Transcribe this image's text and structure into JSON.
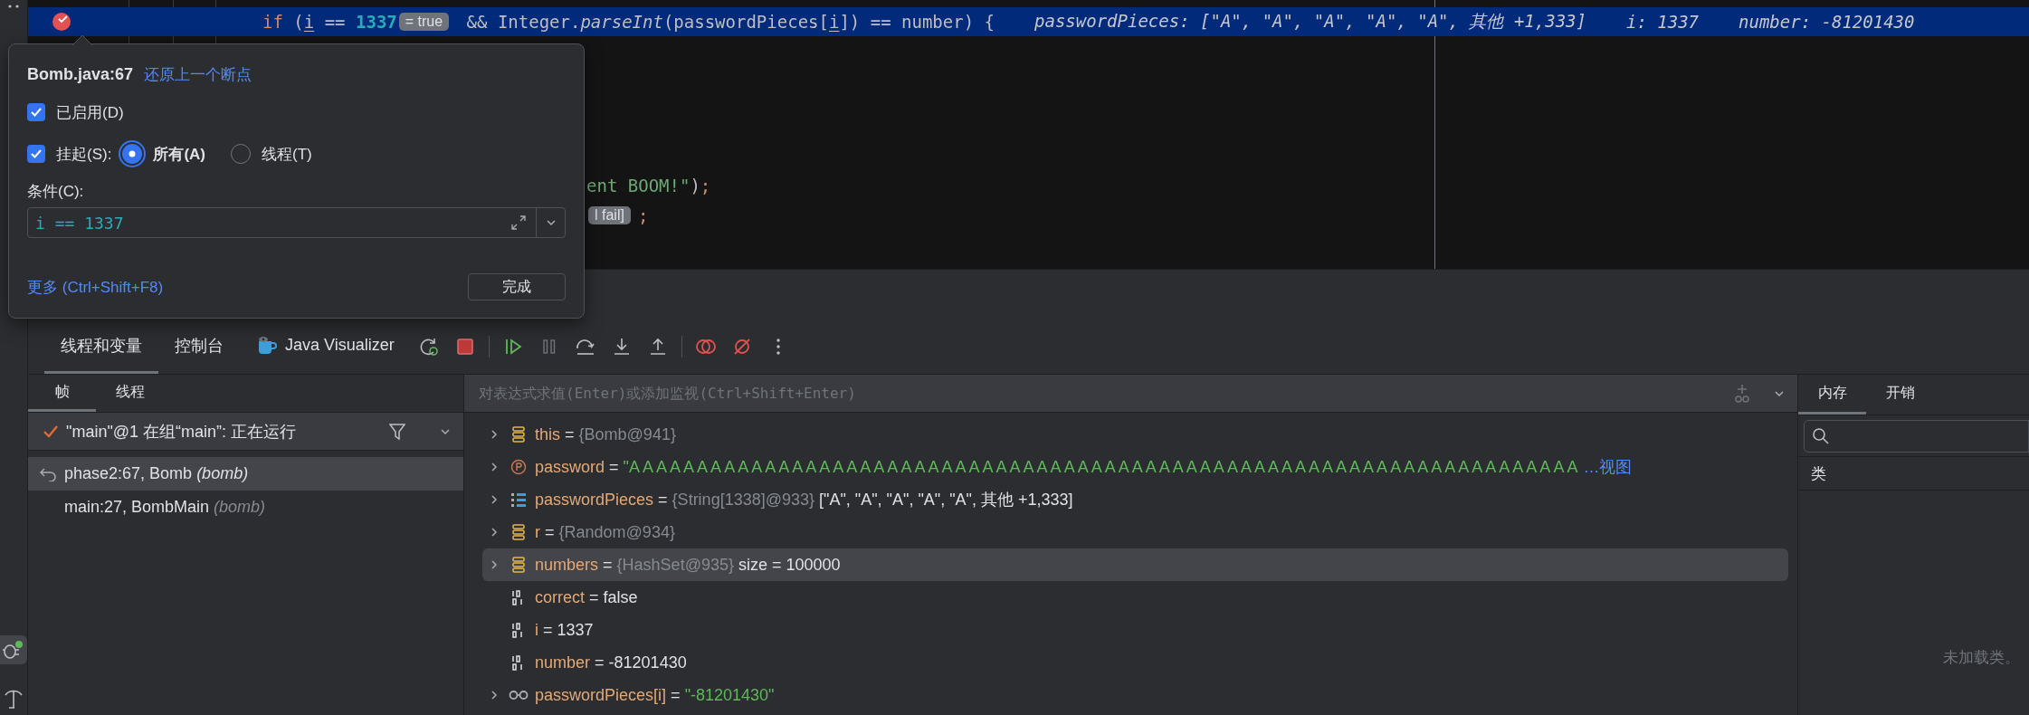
{
  "editor": {
    "current_line": {
      "tokens": [
        {
          "text": "if",
          "kind": "keyword"
        },
        {
          "text": " (",
          "kind": "plain"
        },
        {
          "text": "i",
          "kind": "var"
        },
        {
          "text": " == ",
          "kind": "plain"
        },
        {
          "text": "1337",
          "kind": "number"
        },
        {
          "text": "= true",
          "kind": "hint"
        },
        {
          "text": " && Integer.",
          "kind": "plain"
        },
        {
          "text": "parseInt",
          "kind": "method"
        },
        {
          "text": "(passwordPieces[",
          "kind": "plain"
        },
        {
          "text": "i",
          "kind": "var"
        },
        {
          "text": "]) == number) {",
          "kind": "plain"
        }
      ],
      "inline_values": [
        "passwordPieces: [\"A\", \"A\", \"A\", \"A\", \"A\", 其他 +1,333]",
        "i: 1337",
        "number: -81201430"
      ]
    },
    "partial_lines": [
      {
        "tokens": [
          {
            "text": "ent BOOM!\"",
            "kind": "string"
          },
          {
            "text": ")",
            "kind": "plain"
          },
          {
            "text": ";",
            "kind": "punct"
          }
        ]
      },
      {
        "tokens": [
          {
            "text": "l fail]",
            "kind": "hint"
          },
          {
            "text": ";",
            "kind": "punct"
          }
        ]
      }
    ]
  },
  "breakpoint_popup": {
    "title": "Bomb.java:67",
    "restore_link": "还原上一个断点",
    "enabled": {
      "label": "已启用(D)",
      "checked": true
    },
    "suspend": {
      "label": "挂起(S):",
      "checked": true
    },
    "suspend_options": [
      {
        "label": "所有(A)",
        "selected": true
      },
      {
        "label": "线程(T)",
        "selected": false
      }
    ],
    "condition_label": "条件(C):",
    "condition": "i == 1337",
    "more_link": "更多 (Ctrl+Shift+F8)",
    "done_button": "完成"
  },
  "debug_tabs": [
    {
      "label": "线程和变量",
      "selected": true,
      "kind": "text"
    },
    {
      "label": "控制台",
      "selected": false,
      "kind": "text"
    },
    {
      "label": "Java Visualizer",
      "selected": false,
      "kind": "plugin"
    }
  ],
  "frames_panel": {
    "tabs": [
      {
        "label": "帧",
        "selected": true
      },
      {
        "label": "线程",
        "selected": false
      }
    ],
    "thread": "\"main\"@1 在组“main”: 正在运行",
    "frames": [
      {
        "method": "phase2:67, Bomb",
        "package": "(bomb)",
        "selected": true
      },
      {
        "method": "main:27, BombMain",
        "package": "(bomb)",
        "selected": false
      }
    ]
  },
  "variables_panel": {
    "placeholder": "对表达式求值(Enter)或添加监视(Ctrl+Shift+Enter)",
    "variables": [
      {
        "name": "this",
        "sep": "=",
        "kind": "object",
        "type": "{Bomb@941}",
        "expandable": true,
        "selected": false
      },
      {
        "name": "password",
        "sep": "=",
        "kind": "field",
        "value": {
          "text": "\"A A A A A A A A A A A A A A A A A A A A A A A A A A A A A A A A A A A A A A A A A A A A A A A A A A A A A A A A A A A A A A A A A A A A A A",
          "kind": "string"
        },
        "link": "…视图",
        "expandable": true,
        "selected": false
      },
      {
        "name": "passwordPieces",
        "sep": "=",
        "kind": "array",
        "type": "{String[1338]@933}",
        "value": {
          "text": "[\"A\", \"A\", \"A\", \"A\", \"A\", 其他 +1,333]",
          "kind": "plain"
        },
        "expandable": true,
        "selected": false
      },
      {
        "name": "r",
        "sep": "=",
        "kind": "object",
        "type": "{Random@934}",
        "expandable": true,
        "selected": false
      },
      {
        "name": "numbers",
        "sep": "=",
        "kind": "object",
        "type": "{HashSet@935}",
        "value": {
          "text": "size = 100000",
          "kind": "plain"
        },
        "expandable": true,
        "selected": true
      },
      {
        "name": "correct",
        "sep": "=",
        "kind": "primitive",
        "value": {
          "text": "false",
          "kind": "plain"
        },
        "expandable": false,
        "selected": false
      },
      {
        "name": "i",
        "sep": "=",
        "kind": "primitive",
        "value": {
          "text": "1337",
          "kind": "plain"
        },
        "expandable": false,
        "selected": false
      },
      {
        "name": "number",
        "sep": "=",
        "kind": "primitive",
        "value": {
          "text": "-81201430",
          "kind": "plain"
        },
        "expandable": false,
        "selected": false
      },
      {
        "name": "passwordPieces[i]",
        "sep": "=",
        "kind": "watch",
        "value": {
          "text": "\"-81201430\"",
          "kind": "string"
        },
        "expandable": true,
        "selected": false
      }
    ]
  },
  "memory_panel": {
    "tabs": [
      {
        "label": "内存",
        "selected": true
      },
      {
        "label": "开销",
        "selected": false
      }
    ],
    "column": "类",
    "empty_text": "未加载类。"
  }
}
